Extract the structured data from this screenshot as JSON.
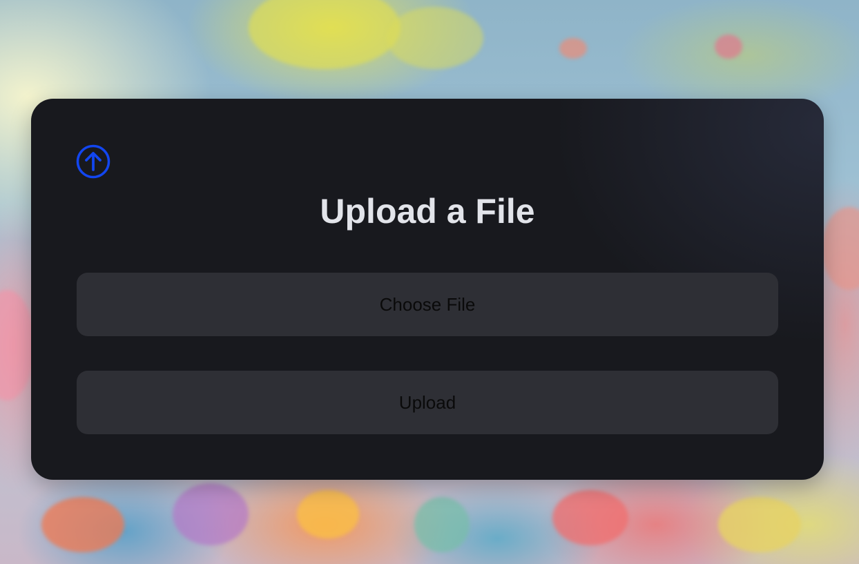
{
  "page": {
    "title": "Upload a File"
  },
  "icons": {
    "upload": "arrow-up-circle-icon"
  },
  "form": {
    "choose_file_label": "Choose File",
    "upload_label": "Upload"
  },
  "colors": {
    "accent": "#1246f0",
    "card_background": "#18191e",
    "button_background": "#2e2f35",
    "title_text": "#e2e4ea",
    "button_text": "#0a0a0a"
  }
}
